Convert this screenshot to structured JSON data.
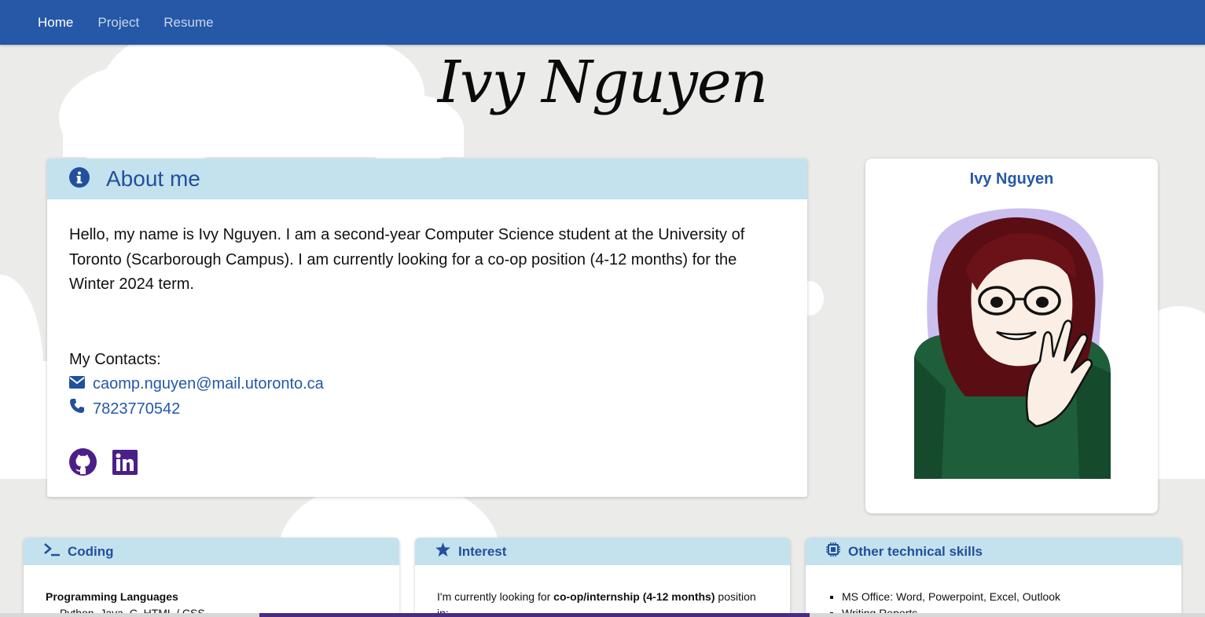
{
  "nav": {
    "items": [
      {
        "label": "Home",
        "active": true
      },
      {
        "label": "Project",
        "active": false
      },
      {
        "label": "Resume",
        "active": false
      }
    ]
  },
  "title": "Ivy Nguyen",
  "about": {
    "heading": "About me",
    "intro": "Hello, my name is Ivy Nguyen. I am a second-year Computer Science student at the University of Toronto (Scarborough Campus). I am currently looking for a co-op position (4-12 months) for the Winter 2024 term.",
    "contacts_label": "My Contacts:",
    "email": "caomp.nguyen@mail.utoronto.ca",
    "phone": "7823770542",
    "social": [
      "github-icon",
      "linkedin-icon"
    ]
  },
  "profile": {
    "name": "Ivy Nguyen"
  },
  "cards": {
    "coding": {
      "heading": "Coding",
      "subheading": "Programming Languages",
      "items": [
        "Python, Java, C, HTML / CSS"
      ]
    },
    "interest": {
      "heading": "Interest",
      "text_prefix": "I'm currently looking for ",
      "text_bold": "co-op/internship (4-12 months)",
      "text_suffix": " position in:"
    },
    "skills": {
      "heading": "Other technical skills",
      "items": [
        "MS Office: Word, Powerpoint, Excel, Outlook",
        "Writing Reports"
      ]
    }
  },
  "colors": {
    "navbar": "#2558a6",
    "header_bg": "#c4e2ee",
    "accent": "#22509c",
    "link": "#2358a8",
    "social": "#4b1f87"
  }
}
